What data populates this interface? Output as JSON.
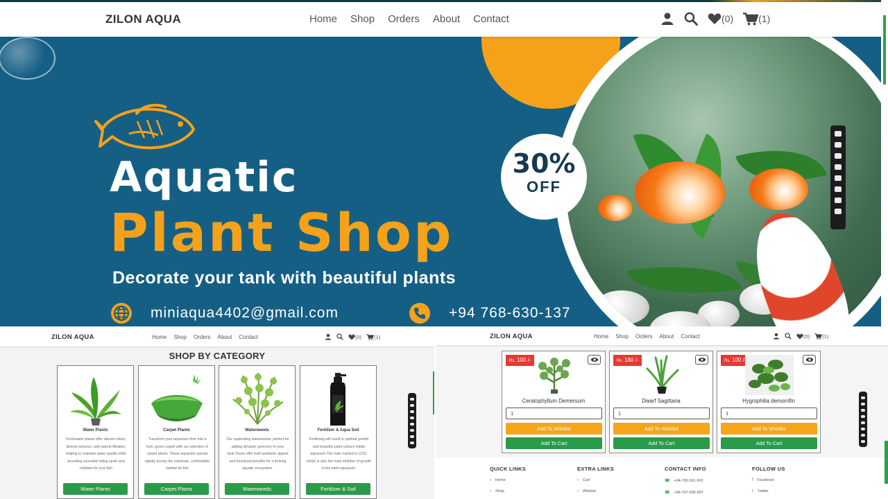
{
  "top_nav": {
    "brand": "ZILON AQUA",
    "menu": [
      "Home",
      "Shop",
      "Orders",
      "About",
      "Contact"
    ],
    "wishlist_count": "(0)",
    "cart_count": "(1)"
  },
  "hero": {
    "line1": "Aquatic",
    "line2": "Plant Shop",
    "tagline": "Decorate your tank with beautiful  plants",
    "email": "miniaqua4402@gmail.com",
    "phone": "+94 768-630-137",
    "discount_pct": "30%",
    "discount_off": "OFF",
    "colors": {
      "background": "#155f85",
      "accent": "#f5a21a"
    }
  },
  "category_page": {
    "nav": {
      "brand": "ZILON AQUA",
      "menu": [
        "Home",
        "Shop",
        "Orders",
        "About",
        "Contact"
      ],
      "wishlist_count": "(0)",
      "cart_count": "(1)"
    },
    "heading": "SHOP BY CATEGORY",
    "categories": [
      {
        "title": "Water Plants",
        "desc": "Freshwater plants offer vibrant colors, diverse textures, and natural filtration, helping to maintain water quality while providing essential hiding spots and habitats for your fish",
        "button": "Water Plants"
      },
      {
        "title": "Carpet Plants",
        "desc": "Transform your aquarium floor into a lush, green carpet with our selection of carpet plants. These aquarium spread rapidly across the substrate, comfortable habitat for fish",
        "button": "Carpet Plants"
      },
      {
        "title": "Waterweeds",
        "desc": "Our captivating waterweeds, perfect for adding dynamic greenery to your tank.These offer both aesthetic appeal and functional benefits for a thriving aquatic ecosystem.",
        "button": "Waterweeds"
      },
      {
        "title": "Fertilizer & Aqua Soil",
        "desc": "Fertilizing will result in optimal growth and beautiful plant colours inside aquarium.The main nutrient is CO2, which is also the main inhibitor of growth in the plant aquarium.",
        "button": "Fertilizer & Soil"
      }
    ]
  },
  "product_page": {
    "nav": {
      "brand": "ZILON AQUA",
      "menu": [
        "Home",
        "Shop",
        "Orders",
        "About",
        "Contact"
      ],
      "wishlist_count": "(0)",
      "cart_count": "(1)"
    },
    "products": [
      {
        "currency": "Rs.",
        "price": "100 /-",
        "name": "Ceratophyllum Demersum",
        "qty": "1",
        "wishlist_label": "Add To Wishlist",
        "cart_label": "Add To Cart"
      },
      {
        "currency": "Rs.",
        "price": "180 /-",
        "name": "Dwarf Sagittaria",
        "qty": "1",
        "wishlist_label": "Add To Wishlist",
        "cart_label": "Add To Cart"
      },
      {
        "currency": "Rs.",
        "price": "100 /-",
        "name": "Hygrophilia demorrifin",
        "qty": "1",
        "wishlist_label": "Add To Wishlist",
        "cart_label": "Add To Cart"
      }
    ],
    "footer": {
      "quick_links": {
        "title": "QUICK LINKS",
        "items": [
          "Home",
          "Shop"
        ]
      },
      "extra_links": {
        "title": "EXTRA LINKS",
        "items": [
          "Cart",
          "Wishlist"
        ]
      },
      "contact_info": {
        "title": "CONTACT INFO",
        "items": [
          "+94-762-561-692",
          "+94-767-005-897"
        ]
      },
      "follow_us": {
        "title": "FOLLOW US",
        "items": [
          "Facebook",
          "Twitter"
        ]
      }
    }
  }
}
